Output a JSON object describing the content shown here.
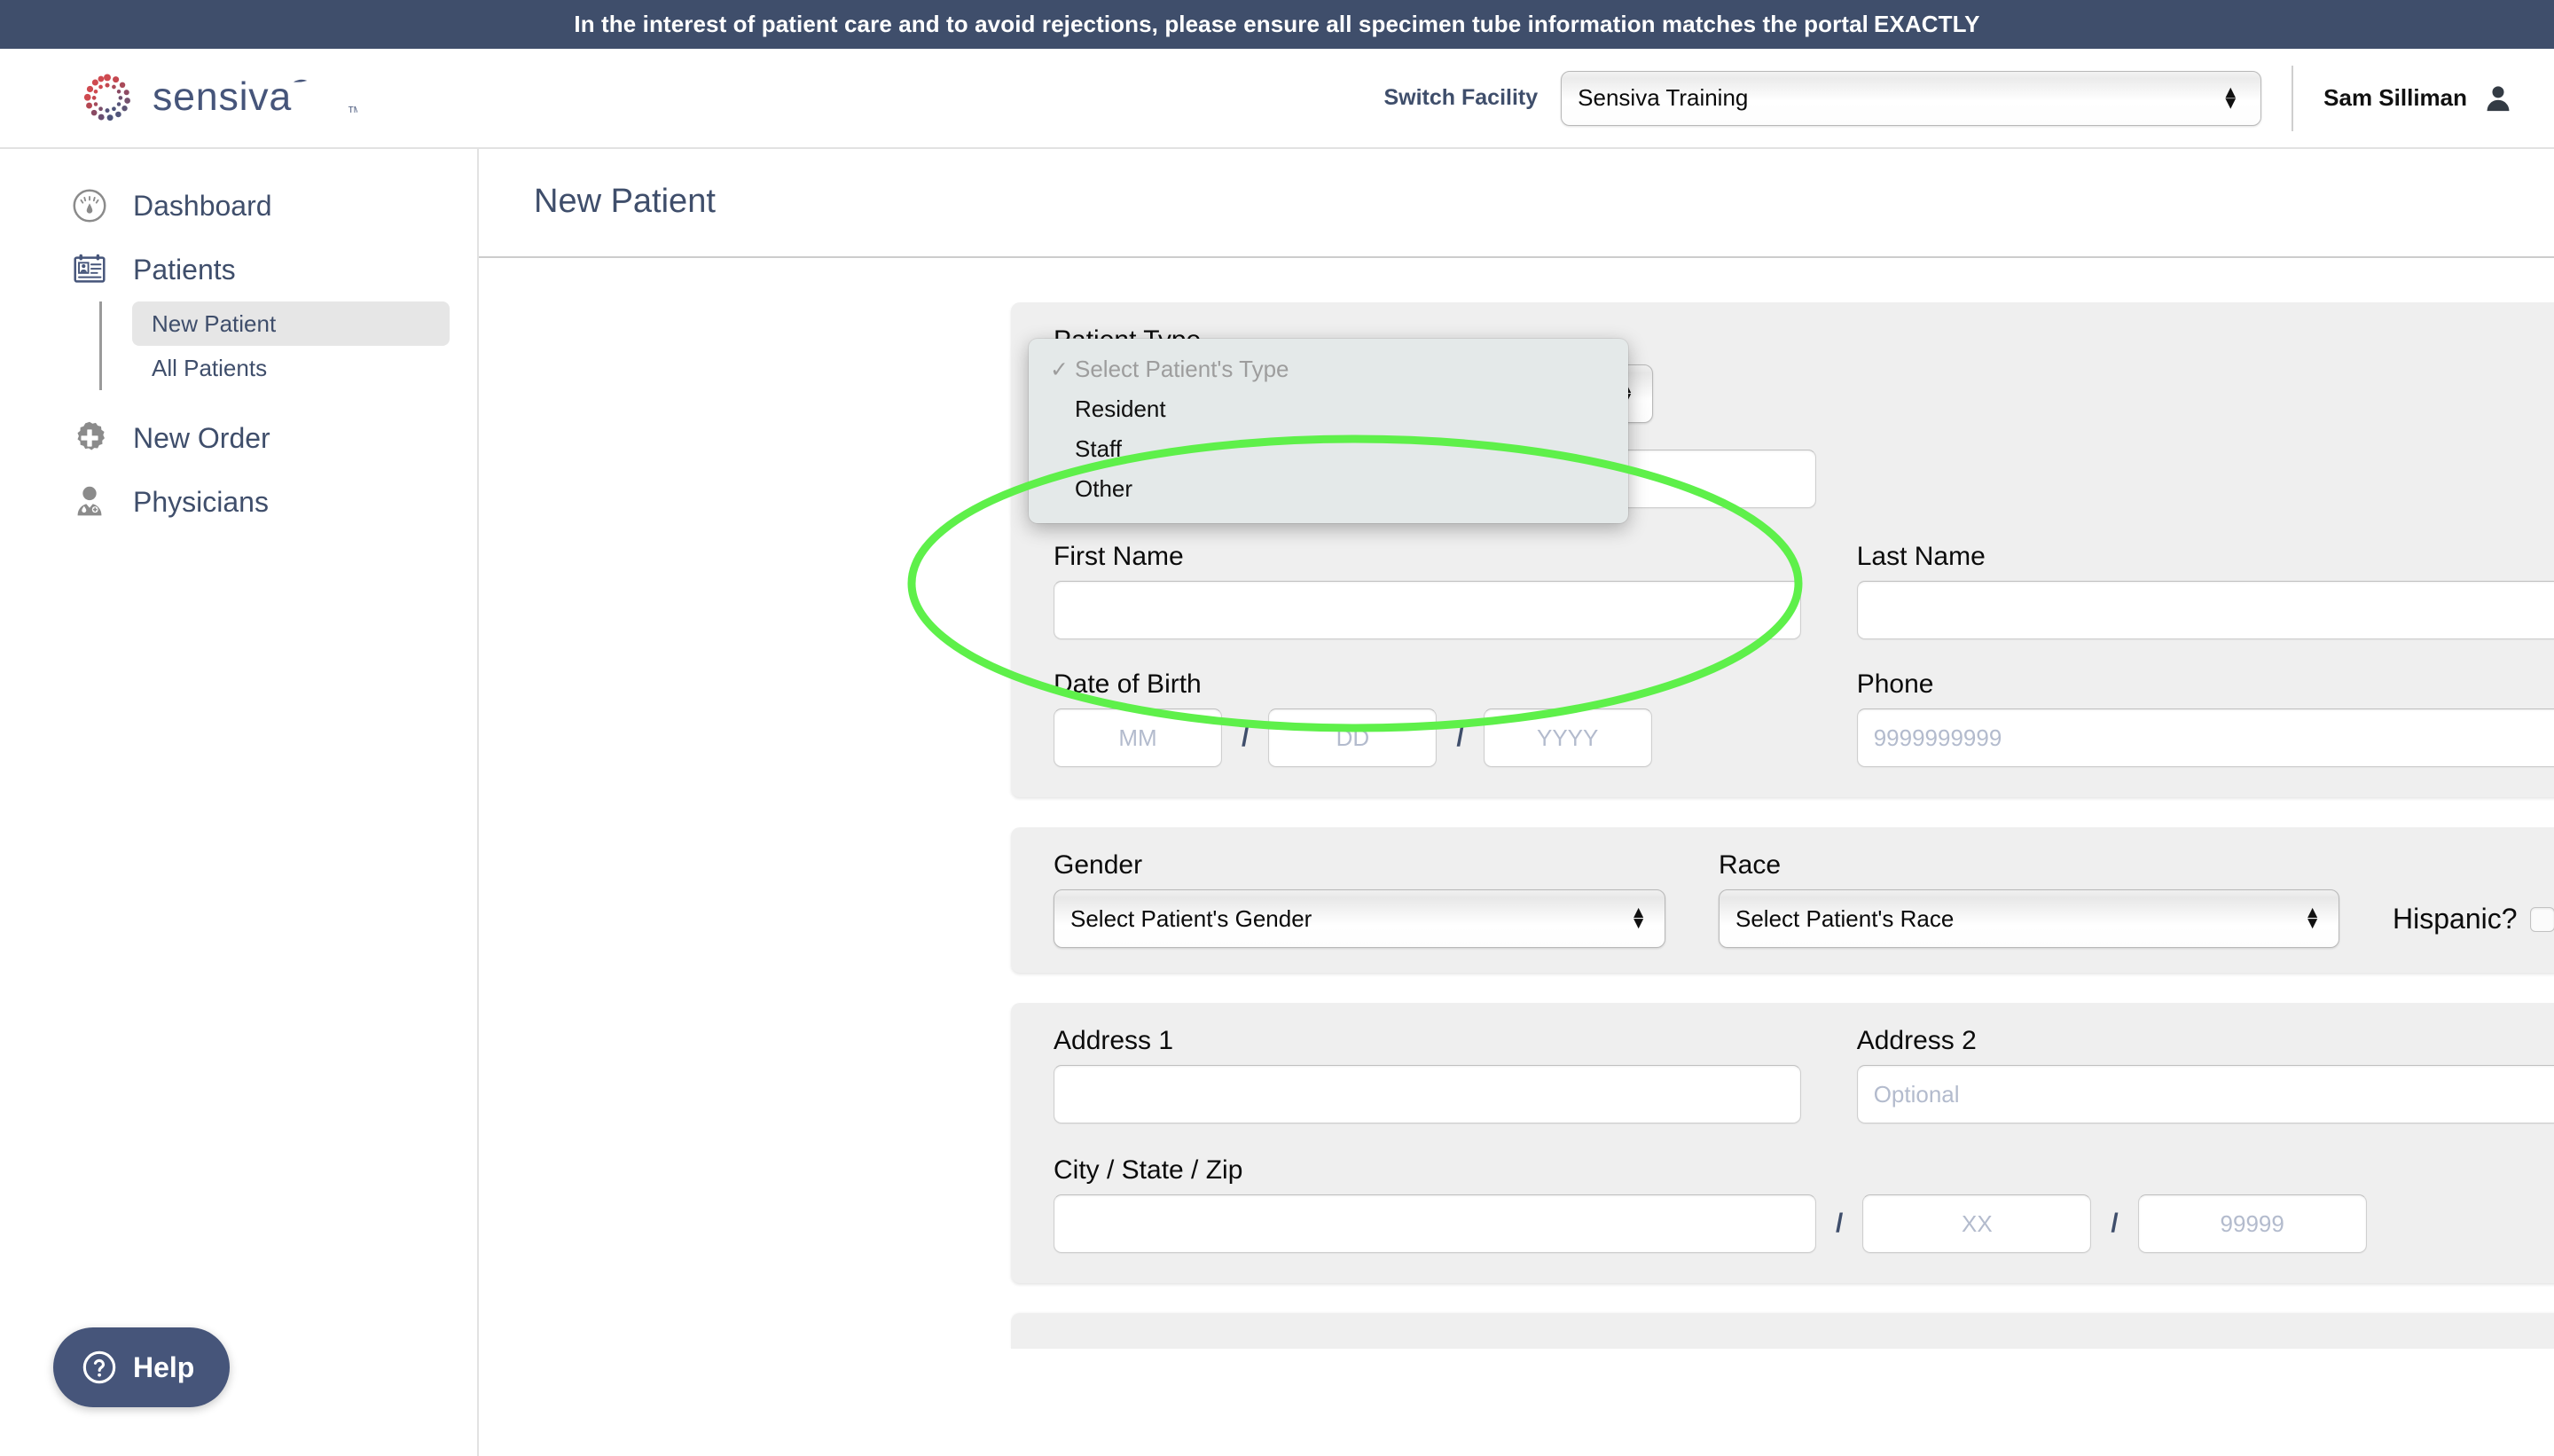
{
  "banner": {
    "text": "In the interest of patient care and to avoid rejections, please ensure all specimen tube information matches the portal ",
    "emphasis": "EXACTLY",
    "background": "#3f4e6b"
  },
  "header": {
    "logo_text": "sensiva",
    "logo_tm": "TM",
    "switch_facility_label": "Switch Facility",
    "facility_value": "Sensiva Training",
    "user_name": "Sam Silliman",
    "avatar_icon": "user-avatar-icon"
  },
  "sidebar": {
    "items": [
      {
        "label": "Dashboard",
        "icon": "gauge-icon"
      },
      {
        "label": "Patients",
        "icon": "id-card-icon"
      },
      {
        "label": "New Order",
        "icon": "plus-badge-icon"
      },
      {
        "label": "Physicians",
        "icon": "doctor-icon"
      }
    ],
    "subitems": [
      {
        "label": "New Patient",
        "active": true
      },
      {
        "label": "All Patients",
        "active": false
      }
    ]
  },
  "main": {
    "page_title": "New Patient"
  },
  "form": {
    "patient_type": {
      "label": "Patient Type",
      "selected": "Select Patient's Type",
      "options": [
        {
          "label": "Select Patient's Type",
          "checked": true,
          "disabled": true
        },
        {
          "label": "Resident",
          "checked": false,
          "disabled": false
        },
        {
          "label": "Staff",
          "checked": false,
          "disabled": false
        },
        {
          "label": "Other",
          "checked": false,
          "disabled": false
        }
      ]
    },
    "first_name": {
      "label": "First Name",
      "value": "",
      "placeholder": ""
    },
    "last_name": {
      "label": "Last Name",
      "value": "",
      "placeholder": ""
    },
    "date_of_birth": {
      "label": "Date of Birth",
      "month_placeholder": "MM",
      "day_placeholder": "DD",
      "year_placeholder": "YYYY",
      "separator": "/"
    },
    "phone": {
      "label": "Phone",
      "placeholder": "9999999999"
    },
    "gender": {
      "label": "Gender",
      "selected": "Select Patient's Gender"
    },
    "race": {
      "label": "Race",
      "selected": "Select Patient's Race"
    },
    "hispanic": {
      "label": "Hispanic?",
      "checked": false
    },
    "address1": {
      "label": "Address 1",
      "placeholder": ""
    },
    "address2": {
      "label": "Address 2",
      "placeholder": "Optional"
    },
    "city_state_zip": {
      "label": "City / State / Zip",
      "city_placeholder": "",
      "state_placeholder": "XX",
      "zip_placeholder": "99999",
      "separator": "/"
    }
  },
  "help": {
    "label": "Help",
    "icon": "question-circle-icon"
  },
  "annotation": {
    "shape": "ellipse",
    "color": "#5ef04a",
    "target": "patient-type-dropdown"
  },
  "colors": {
    "brand_navy": "#3f4e6b",
    "panel_grey": "#efefef",
    "annotation_green": "#5ef04a",
    "logo_red": "#c8434f",
    "logo_blue": "#46557a"
  }
}
